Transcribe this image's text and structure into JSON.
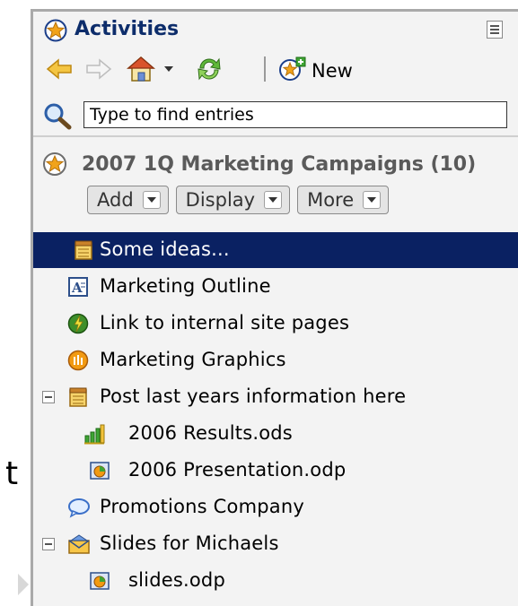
{
  "gutter": {
    "stray_text": "t"
  },
  "panel": {
    "title": "Activities",
    "toolbar": {
      "new_label": "New"
    },
    "search": {
      "placeholder": "Type to find entries"
    },
    "activity": {
      "name": "2007 1Q Marketing Campaigns (10)",
      "buttons": [
        "Add",
        "Display",
        "More"
      ]
    },
    "entries": [
      {
        "label": "Some ideas...",
        "icon": "notepad-icon",
        "selected": true
      },
      {
        "label": "Marketing Outline",
        "icon": "document-a-icon"
      },
      {
        "label": "Link to internal site pages",
        "icon": "link-icon"
      },
      {
        "label": "Marketing Graphics",
        "icon": "graphics-icon"
      },
      {
        "label": "Post last years information here",
        "icon": "notepad-icon",
        "expanded": true
      },
      {
        "label": "2006 Results.ods",
        "icon": "spreadsheet-icon"
      },
      {
        "label": "2006 Presentation.odp",
        "icon": "presentation-icon"
      },
      {
        "label": "Promotions Company",
        "icon": "speech-bubble-icon"
      },
      {
        "label": "Slides for Michaels",
        "icon": "mail-folder-icon",
        "expanded": true
      },
      {
        "label": "slides.odp",
        "icon": "presentation-icon"
      }
    ]
  },
  "colors": {
    "selection": "#0a2162",
    "title": "#0d2d6b",
    "activity_name": "#5a5a5a"
  }
}
